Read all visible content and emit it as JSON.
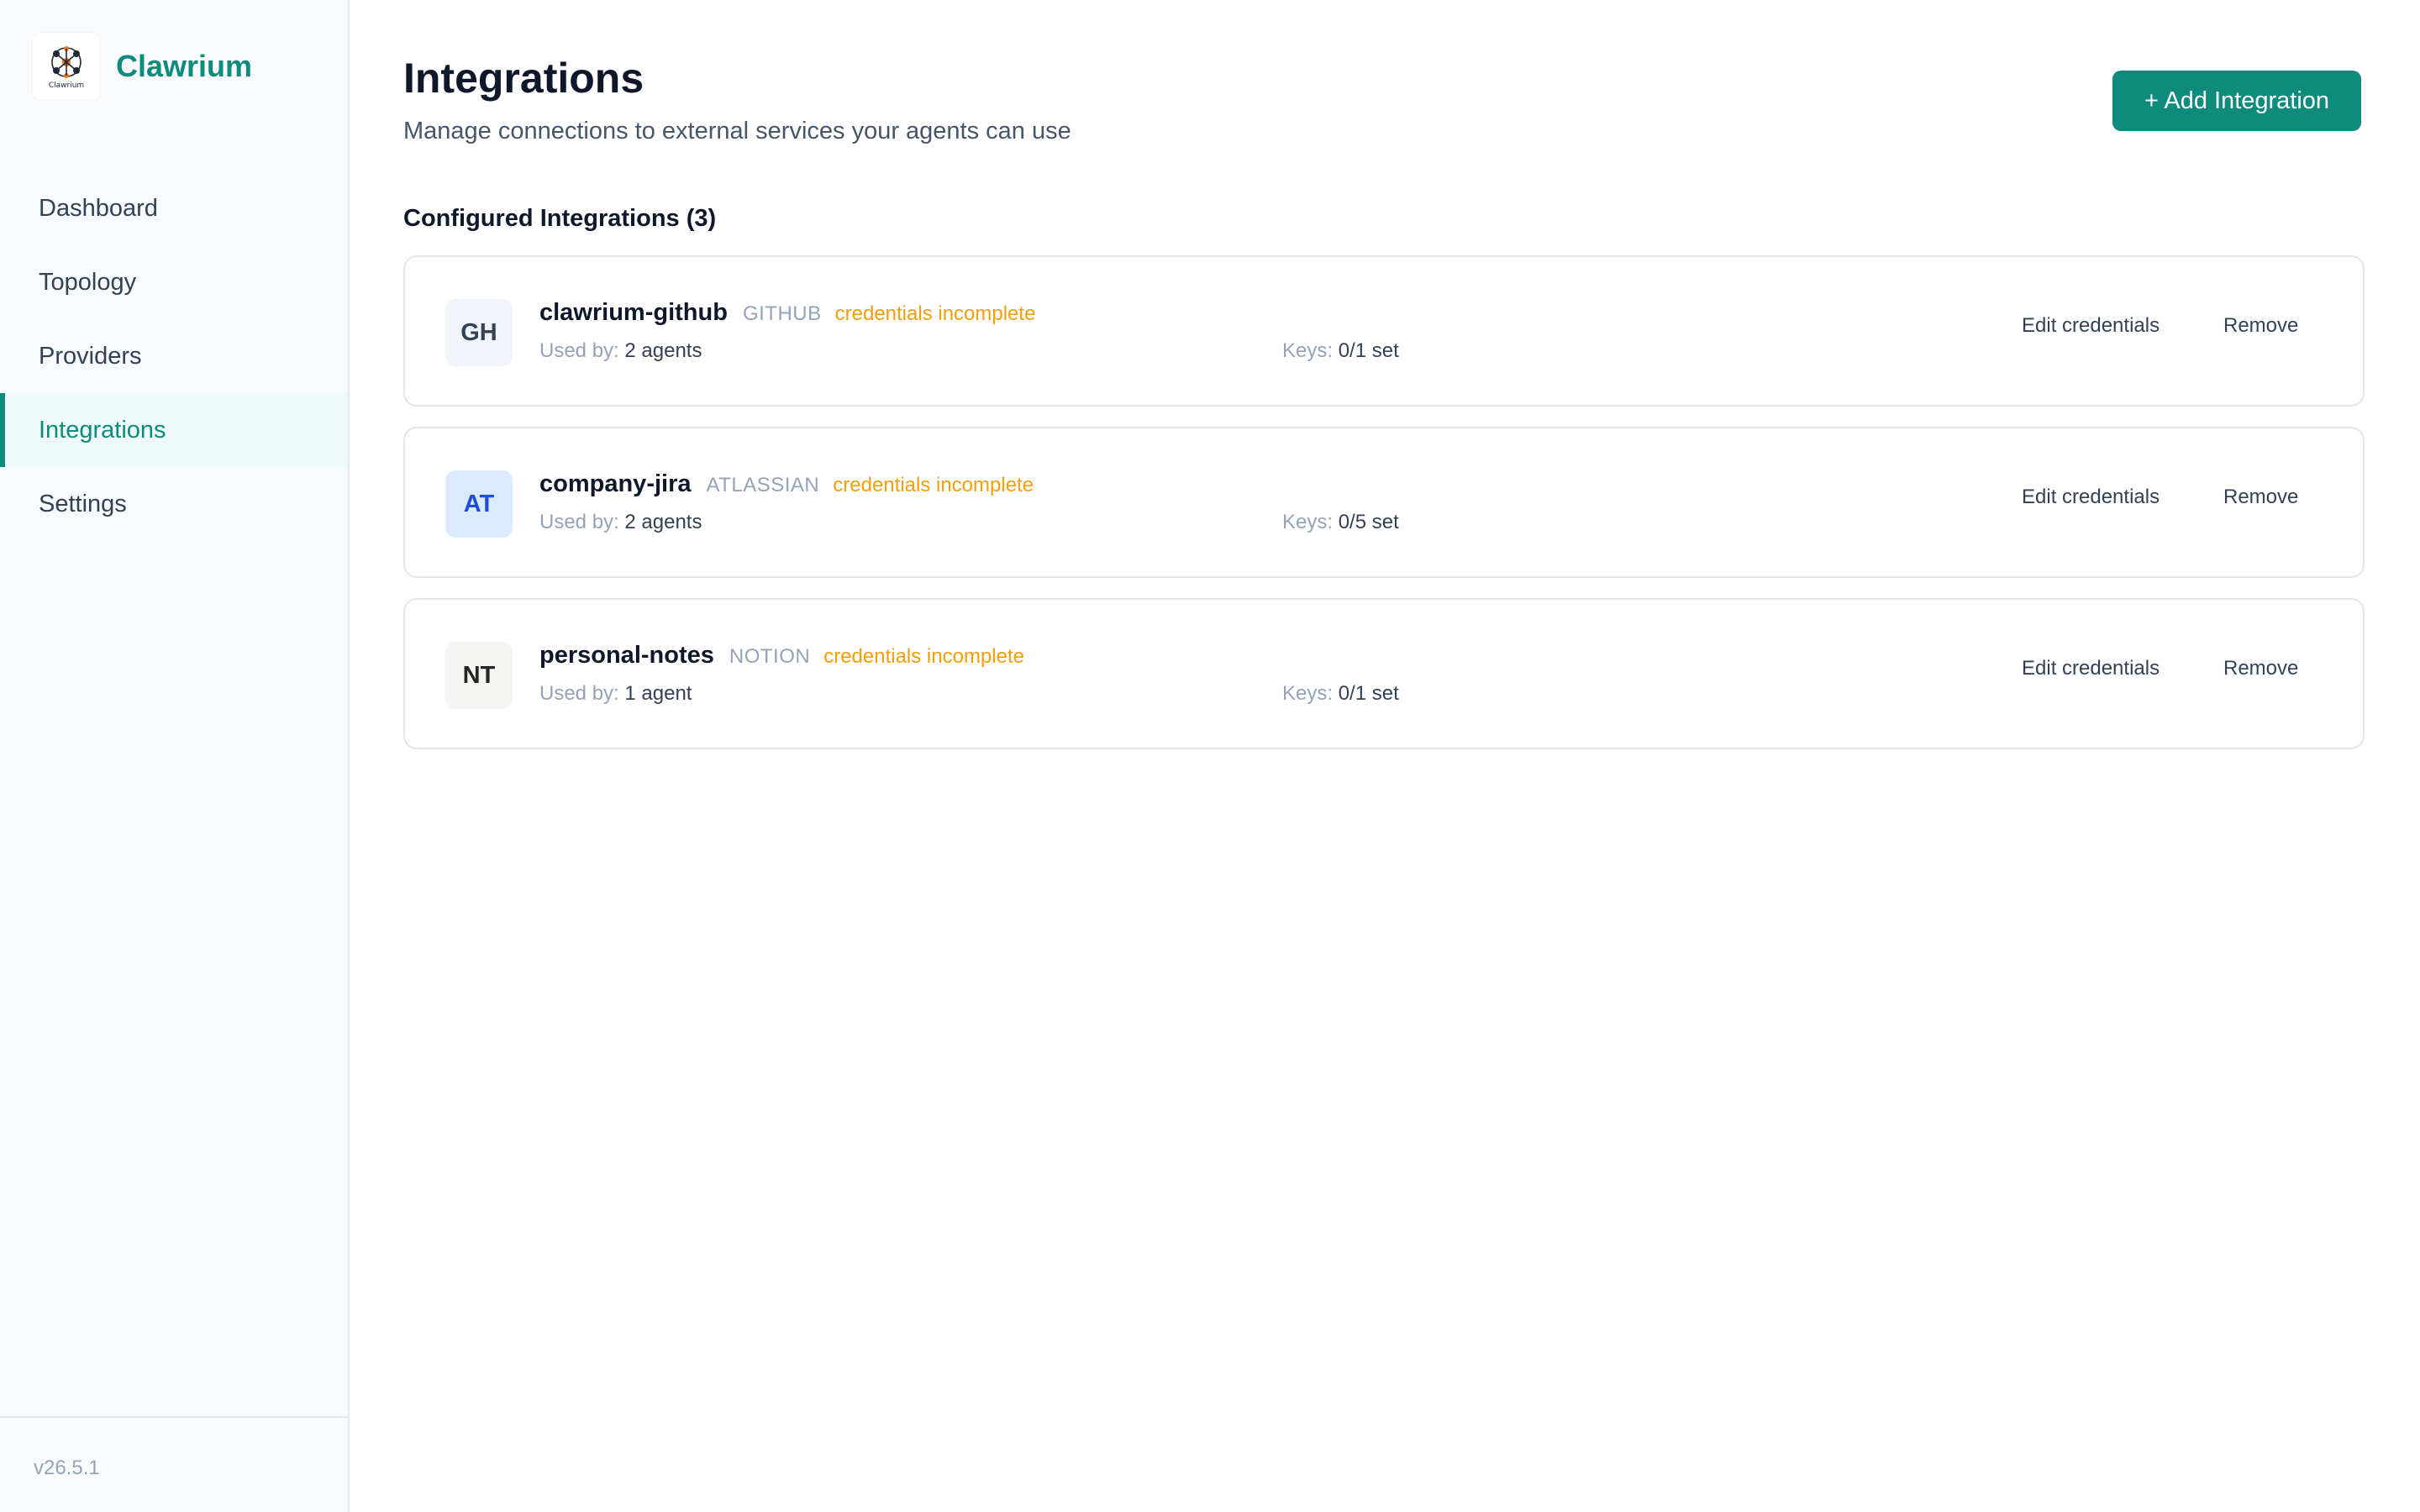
{
  "brand": {
    "name": "Clawrium",
    "logo_caption": "Clawrium",
    "logo_icon": "molecule-network-icon"
  },
  "nav": {
    "items": [
      {
        "label": "Dashboard",
        "active": false
      },
      {
        "label": "Topology",
        "active": false
      },
      {
        "label": "Providers",
        "active": false
      },
      {
        "label": "Integrations",
        "active": true
      },
      {
        "label": "Settings",
        "active": false
      }
    ]
  },
  "footer": {
    "version": "v26.5.1"
  },
  "header": {
    "title": "Integrations",
    "subtitle": "Manage connections to external services your agents can use",
    "add_button_label": "+ Add Integration"
  },
  "section": {
    "title": "Configured Integrations (3)"
  },
  "integrations": [
    {
      "initials": "GH",
      "name": "clawrium-github",
      "type": "GITHUB",
      "status": "credentials incomplete",
      "used_by_label": "Used by:",
      "used_by": "2 agents",
      "keys_label": "Keys:",
      "keys": "0/1 set",
      "edit_label": "Edit credentials",
      "remove_label": "Remove",
      "avatar_bg": "#f1f5f9",
      "avatar_fg": "#334155"
    },
    {
      "initials": "AT",
      "name": "company-jira",
      "type": "ATLASSIAN",
      "status": "credentials incomplete",
      "used_by_label": "Used by:",
      "used_by": "2 agents",
      "keys_label": "Keys:",
      "keys": "0/5 set",
      "edit_label": "Edit credentials",
      "remove_label": "Remove",
      "avatar_bg": "#dbeafe",
      "avatar_fg": "#1d4ed8"
    },
    {
      "initials": "NT",
      "name": "personal-notes",
      "type": "NOTION",
      "status": "credentials incomplete",
      "used_by_label": "Used by:",
      "used_by": "1 agent",
      "keys_label": "Keys:",
      "keys": "0/1 set",
      "edit_label": "Edit credentials",
      "remove_label": "Remove",
      "avatar_bg": "#f5f5f4",
      "avatar_fg": "#292524"
    }
  ],
  "colors": {
    "accent": "#0f8b7e",
    "warning": "#f59e0b"
  }
}
